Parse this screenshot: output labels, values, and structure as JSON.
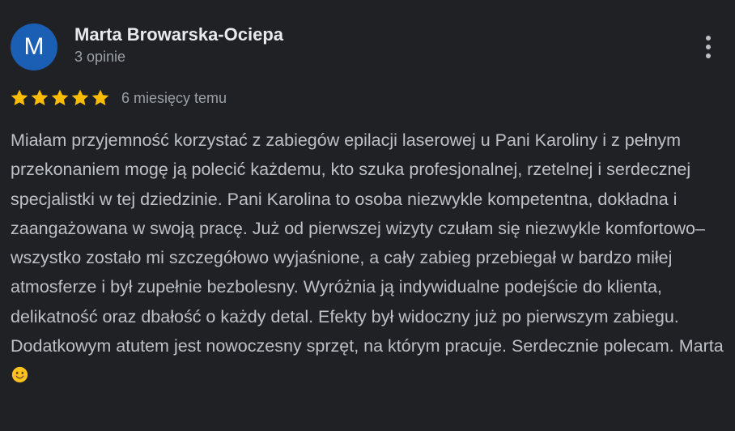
{
  "review": {
    "author": {
      "initial": "M",
      "name": "Marta Browarska-Ociepa",
      "meta": "3 opinie",
      "avatar_color": "#1a5fb4"
    },
    "menu_icon": "more-vert-icon",
    "rating": {
      "stars": 5,
      "max": 5,
      "star_color": "#fbbc04",
      "time": "6 miesięcy temu"
    },
    "text": "Miałam przyjemność korzystać z zabiegów epilacji laserowej u Pani Karoliny i z pełnym przekonaniem mogę ją polecić każdemu, kto szuka profesjonalnej, rzetelnej i serdecznej specjalistki w tej dziedzinie. Pani Karolina to osoba niezwykle kompetentna, dokładna i zaangażowana w swoją pracę. Już od pierwszej wizyty czułam się niezwykle komfortowo– wszystko zostało mi szczegółowo wyjaśnione, a cały zabieg przebiegał w bardzo miłej atmosferze i był zupełnie bezbolesny. Wyróżnia ją indywidualne podejście do klienta, delikatność oraz dbałość o każdy detal. Efekty był widoczny już po pierwszym zabiegu. Dodatkowym atutem jest nowoczesny sprzęt, na którym pracuje. Serdecznie polecam. Marta",
    "text_emoji": "smiling-face-emoji"
  }
}
